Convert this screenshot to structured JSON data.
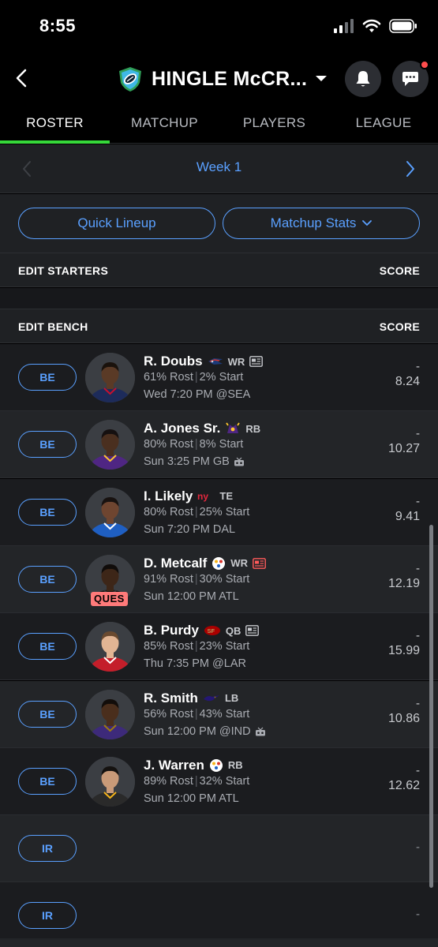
{
  "status_bar": {
    "time": "8:55"
  },
  "header": {
    "league_title": "HINGLE McCR...",
    "icons": {
      "back": "chevron-left-icon",
      "league_logo": "football-shield-icon",
      "dropdown": "chevron-down-icon",
      "notifications": "bell-icon",
      "messages": "chat-icon"
    }
  },
  "tabs": [
    {
      "label": "ROSTER",
      "active": true
    },
    {
      "label": "MATCHUP",
      "active": false
    },
    {
      "label": "PLAYERS",
      "active": false
    },
    {
      "label": "LEAGUE",
      "active": false
    }
  ],
  "week": {
    "label": "Week 1"
  },
  "actions": {
    "quick_lineup": "Quick Lineup",
    "matchup_stats": "Matchup Stats"
  },
  "starters": {
    "label": "EDIT STARTERS",
    "score_label": "SCORE"
  },
  "bench": {
    "label": "EDIT BENCH",
    "score_label": "SCORE"
  },
  "players": [
    {
      "slot": "BE",
      "name": "R. Doubs",
      "team_icon": "patriots-logo-icon",
      "pos": "WR",
      "has_news": true,
      "news_alert": false,
      "rost": "61% Rost",
      "start": "2% Start",
      "game": "Wed 7:20 PM @SEA",
      "tv": false,
      "status": "",
      "proj": "-",
      "score": "8.24"
    },
    {
      "slot": "BE",
      "name": "A. Jones Sr.",
      "team_icon": "vikings-logo-icon",
      "pos": "RB",
      "has_news": false,
      "news_alert": false,
      "rost": "80% Rost",
      "start": "8% Start",
      "game": "Sun 3:25 PM GB",
      "tv": true,
      "status": "",
      "proj": "-",
      "score": "10.27"
    },
    {
      "slot": "BE",
      "name": "I. Likely",
      "team_icon": "giants-logo-icon",
      "pos": "TE",
      "has_news": false,
      "news_alert": false,
      "rost": "80% Rost",
      "start": "25% Start",
      "game": "Sun 7:20 PM DAL",
      "tv": false,
      "status": "",
      "proj": "-",
      "score": "9.41"
    },
    {
      "slot": "BE",
      "name": "D. Metcalf",
      "team_icon": "steelers-logo-icon",
      "pos": "WR",
      "has_news": true,
      "news_alert": true,
      "rost": "91% Rost",
      "start": "30% Start",
      "game": "Sun 12:00 PM ATL",
      "tv": false,
      "status": "QUES",
      "proj": "-",
      "score": "12.19"
    },
    {
      "slot": "BE",
      "name": "B. Purdy",
      "team_icon": "49ers-logo-icon",
      "pos": "QB",
      "has_news": true,
      "news_alert": false,
      "rost": "85% Rost",
      "start": "23% Start",
      "game": "Thu 7:35 PM @LAR",
      "tv": false,
      "status": "",
      "proj": "-",
      "score": "15.99"
    },
    {
      "slot": "BE",
      "name": "R. Smith",
      "team_icon": "ravens-logo-icon",
      "pos": "LB",
      "has_news": false,
      "news_alert": false,
      "rost": "56% Rost",
      "start": "43% Start",
      "game": "Sun 12:00 PM @IND",
      "tv": true,
      "status": "",
      "proj": "-",
      "score": "10.86"
    },
    {
      "slot": "BE",
      "name": "J. Warren",
      "team_icon": "steelers-logo-icon",
      "pos": "RB",
      "has_news": false,
      "news_alert": false,
      "rost": "89% Rost",
      "start": "32% Start",
      "game": "Sun 12:00 PM ATL",
      "tv": false,
      "status": "",
      "proj": "-",
      "score": "12.62"
    }
  ],
  "ir_slots": [
    {
      "slot": "IR",
      "score": "-"
    },
    {
      "slot": "IR",
      "score": "-"
    }
  ],
  "colors": {
    "accent": "#5aa0ff",
    "tab_active_underline": "#36d83a",
    "status_ques": "#ff7a7a",
    "notification_dot": "#ff4d4d"
  }
}
